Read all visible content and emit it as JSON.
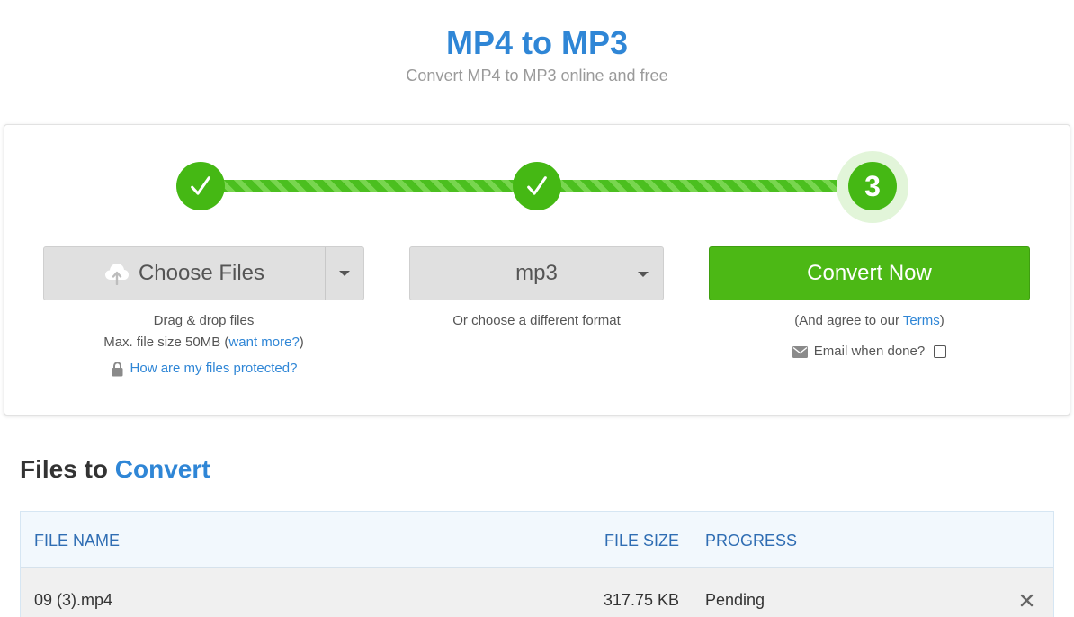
{
  "header": {
    "title": "MP4 to MP3",
    "subtitle": "Convert MP4 to MP3 online and free"
  },
  "steps": [
    {
      "state": "done",
      "icon": "checkmark-icon"
    },
    {
      "state": "done",
      "icon": "checkmark-icon"
    },
    {
      "state": "current",
      "number": "3"
    }
  ],
  "upload": {
    "choose_files_label": "Choose Files",
    "drag_drop": "Drag & drop files",
    "max_size_prefix": "Max. file size 50MB (",
    "want_more": "want more?",
    "max_size_suffix": ")",
    "protected_link": "How are my files protected?"
  },
  "format": {
    "selected": "mp3",
    "hint": "Or choose a different format"
  },
  "convert": {
    "button_label": "Convert Now",
    "terms_prefix": "(And agree to our ",
    "terms_link": "Terms",
    "terms_suffix": ")",
    "email_label": "Email when done?",
    "email_checked": false
  },
  "files_section": {
    "title_part1": "Files to",
    "title_part2": "Convert",
    "columns": {
      "name": "FILE NAME",
      "size": "FILE SIZE",
      "progress": "PROGRESS"
    },
    "rows": [
      {
        "name": "09 (3).mp4",
        "size": "317.75 KB",
        "progress": "Pending"
      }
    ]
  },
  "colors": {
    "accent_blue": "#2f86d6",
    "success_green": "#4cb815",
    "table_header_bg": "#f2f8fd"
  }
}
